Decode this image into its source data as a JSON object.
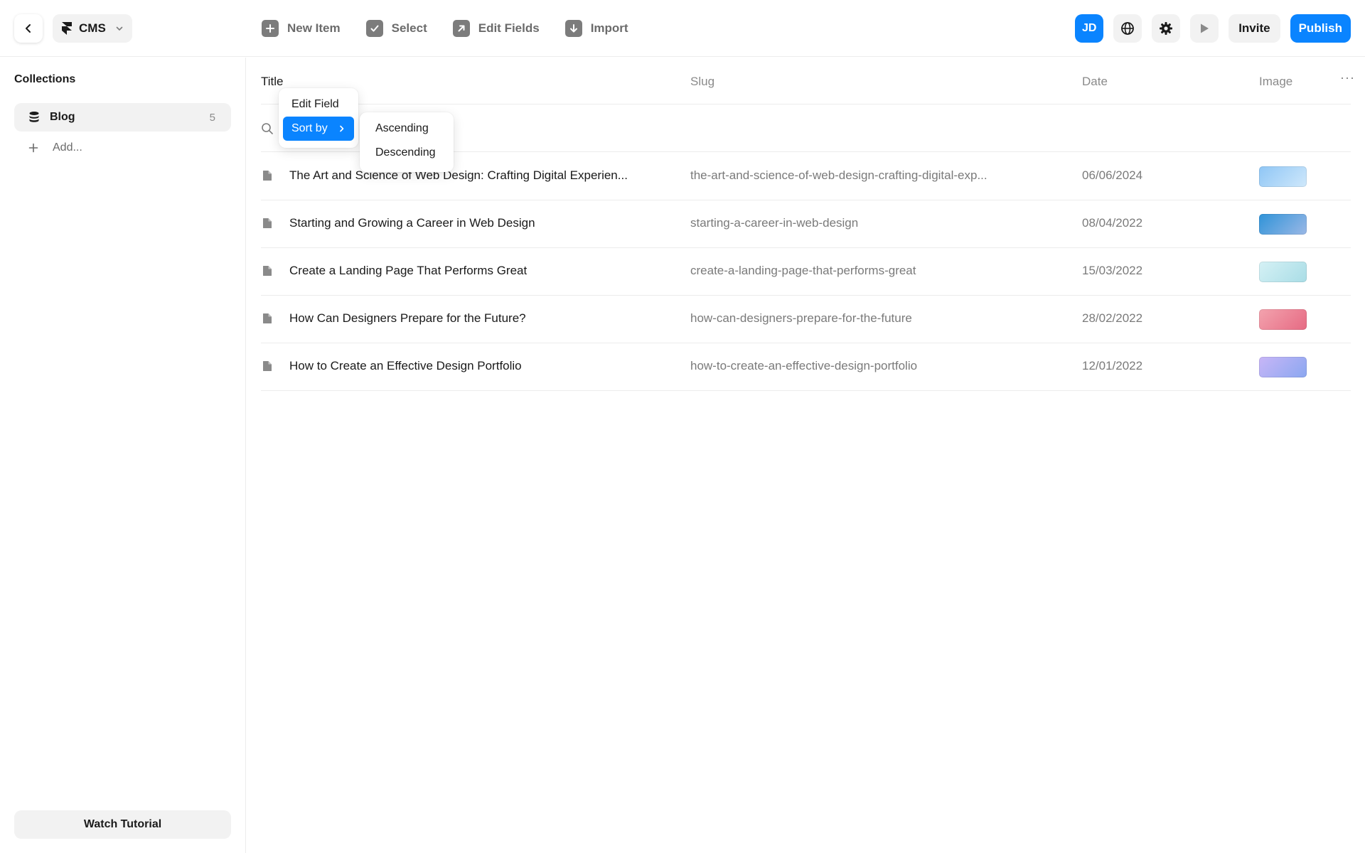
{
  "header": {
    "cms_label": "CMS",
    "toolbar": [
      {
        "label": "New Item",
        "icon": "plus-icon"
      },
      {
        "label": "Select",
        "icon": "checkbox-icon"
      },
      {
        "label": "Edit Fields",
        "icon": "arrow-up-right-icon"
      },
      {
        "label": "Import",
        "icon": "arrow-down-icon"
      }
    ],
    "avatar_initials": "JD",
    "invite_label": "Invite",
    "publish_label": "Publish"
  },
  "sidebar": {
    "title": "Collections",
    "collections": [
      {
        "name": "Blog",
        "count": "5"
      }
    ],
    "add_label": "Add...",
    "watch_tutorial_label": "Watch Tutorial"
  },
  "table": {
    "columns": {
      "title": "Title",
      "slug": "Slug",
      "date": "Date",
      "image": "Image"
    },
    "more_label": "···",
    "search_value": "",
    "rows": [
      {
        "title": "The Art and Science of Web Design: Crafting Digital Experien...",
        "slug": "the-art-and-science-of-web-design-crafting-digital-exp...",
        "date": "06/06/2024",
        "thumb_colors": [
          "#8fc6f5",
          "#cfe8fb"
        ]
      },
      {
        "title": "Starting and Growing a Career in Web Design",
        "slug": "starting-a-career-in-web-design",
        "date": "08/04/2022",
        "thumb_colors": [
          "#2f93d8",
          "#9bb8e6"
        ]
      },
      {
        "title": "Create a Landing Page That Performs Great",
        "slug": "create-a-landing-page-that-performs-great",
        "date": "15/03/2022",
        "thumb_colors": [
          "#d5f1f5",
          "#a9dde6"
        ]
      },
      {
        "title": "How Can Designers Prepare for the Future?",
        "slug": "how-can-designers-prepare-for-the-future",
        "date": "28/02/2022",
        "thumb_colors": [
          "#f3a3ae",
          "#e66a83"
        ]
      },
      {
        "title": "How to Create an Effective Design Portfolio",
        "slug": "how-to-create-an-effective-design-portfolio",
        "date": "12/01/2022",
        "thumb_colors": [
          "#c8b6f7",
          "#8aa7f0"
        ]
      }
    ]
  },
  "context_menu": {
    "items": [
      "Edit Field",
      "Sort by"
    ],
    "active_item": "Sort by",
    "submenu": [
      "Ascending",
      "Descending"
    ]
  },
  "colors": {
    "accent": "#0a84ff",
    "muted_text": "#7a7a7a",
    "surface": "#f2f2f2"
  }
}
